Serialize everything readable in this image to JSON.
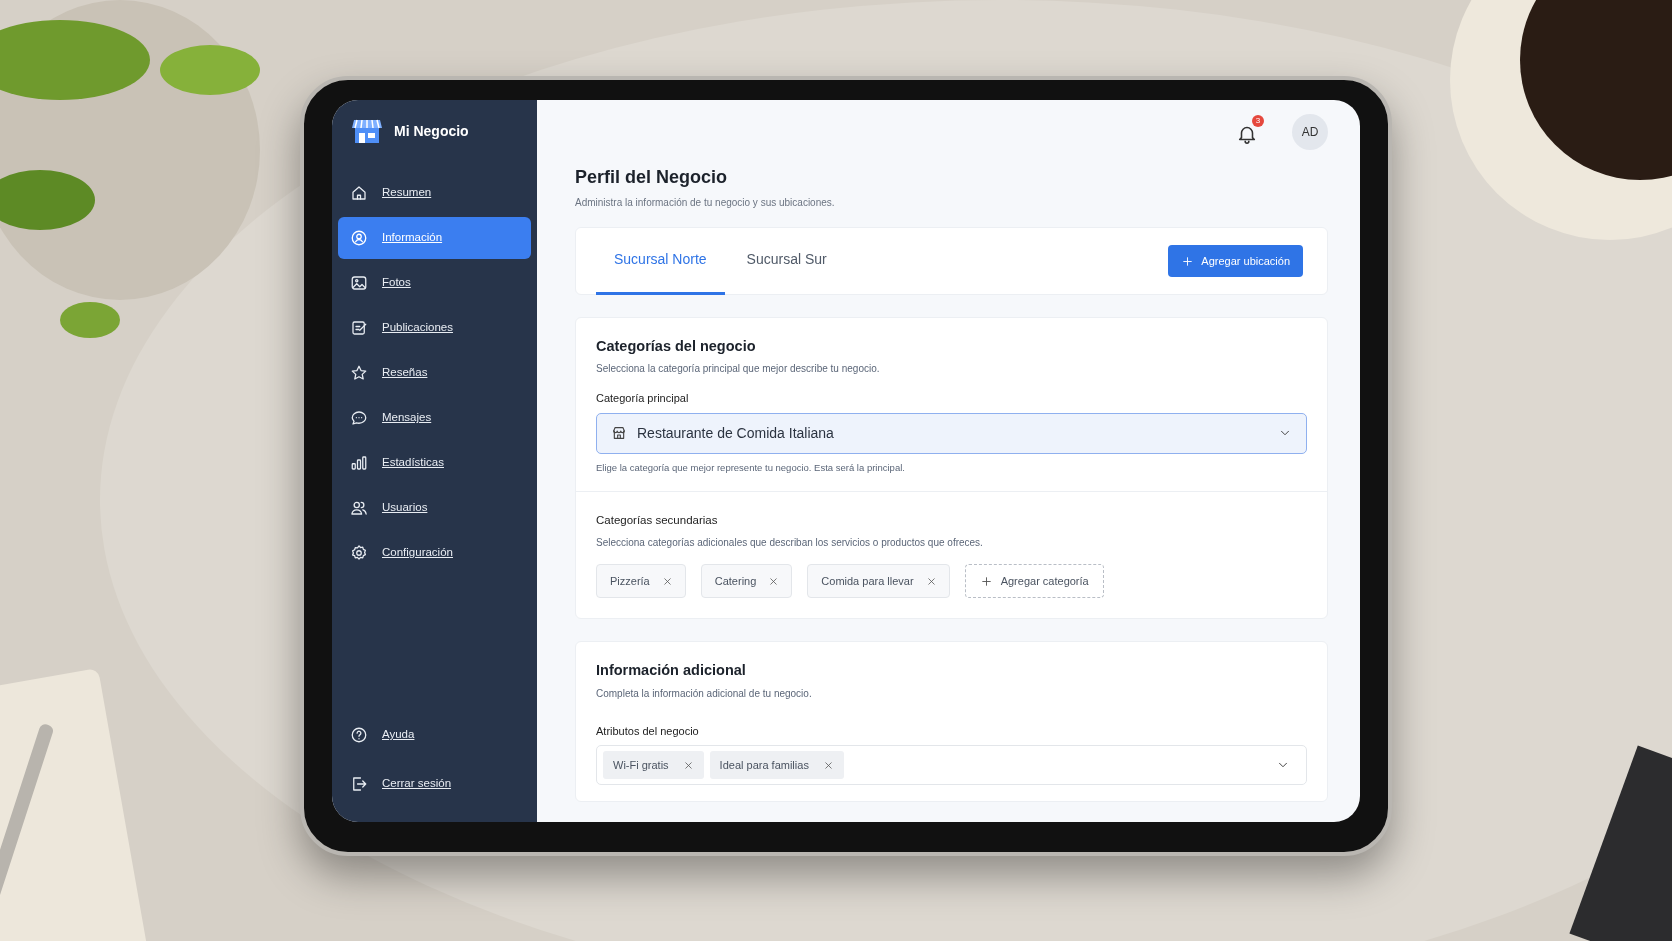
{
  "app": {
    "brand": "Mi Negocio"
  },
  "sidebar": {
    "items": [
      {
        "label": "Resumen",
        "selected": false
      },
      {
        "label": "Información",
        "selected": true
      },
      {
        "label": "Fotos",
        "selected": false
      },
      {
        "label": "Publicaciones",
        "selected": false
      },
      {
        "label": "Reseñas",
        "selected": false
      },
      {
        "label": "Mensajes",
        "selected": false
      },
      {
        "label": "Estadísticas",
        "selected": false
      },
      {
        "label": "Usuarios",
        "selected": false
      },
      {
        "label": "Configuración",
        "selected": false
      }
    ],
    "footer_items": [
      {
        "label": "Ayuda"
      },
      {
        "label": "Cerrar sesión"
      }
    ]
  },
  "header": {
    "notification_count": "3",
    "avatar": "AD"
  },
  "page": {
    "title": "Perfil del Negocio",
    "subtitle": "Administra la información de tu negocio y sus ubicaciones."
  },
  "tabs": [
    {
      "label": "Sucursal Norte",
      "selected": true
    },
    {
      "label": "Sucursal Sur",
      "selected": false
    }
  ],
  "add_location_button": "Agregar ubicación",
  "categories": {
    "title": "Categorías del negocio",
    "description": "Selecciona la categoría principal que mejor describe tu negocio.",
    "primary_label": "Categoría principal",
    "primary_value": "Restaurante de Comida Italiana",
    "primary_help": "Elige la categoría que mejor represente tu negocio. Esta será la principal.",
    "secondary_title": "Categorías secundarias",
    "secondary_description": "Selecciona categorías adicionales que describan los servicios o productos que ofreces.",
    "secondary_tags": [
      "Pizzería",
      "Catering",
      "Comida para llevar"
    ],
    "add_button": "Agregar categoría"
  },
  "additional": {
    "title": "Información adicional",
    "description": "Completa la información adicional de tu negocio.",
    "attributes_label": "Atributos del negocio",
    "attributes": [
      "Wi-Fi gratis",
      "Ideal para familias"
    ]
  }
}
